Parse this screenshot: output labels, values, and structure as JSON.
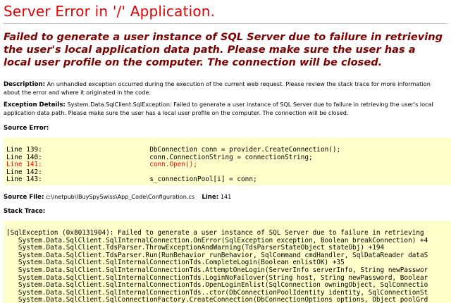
{
  "page": {
    "title": "Server Error in '/' Application.",
    "error_message": "Failed to generate a user instance of SQL Server due to failure in retrieving the user's local application data path. Please make sure the user has a local user profile on the computer. The connection will be closed."
  },
  "description": {
    "label": "Description:",
    "text": "An unhandled exception occurred during the execution of the current web request. Please review the stack trace for more information about the error and where it originated in the code."
  },
  "exception_details": {
    "label": "Exception Details:",
    "text": "System.Data.SqlClient.SqlException: Failed to generate a user instance of SQL Server due to failure in retrieving the user's local application data path. Please make sure the user has a local user profile on the computer. The connection will be closed."
  },
  "source_error": {
    "label": "Source Error:",
    "lines": [
      {
        "line": "Line 139:",
        "code": "DbConnection conn = provider.CreateConnection();",
        "highlight": false
      },
      {
        "line": "Line 140:",
        "code": "conn.ConnectionString = connectionString;",
        "highlight": false
      },
      {
        "line": "Line 141:",
        "code": "conn.Open();",
        "highlight": true
      },
      {
        "line": "Line 142:",
        "code": "",
        "highlight": false
      },
      {
        "line": "Line 143:",
        "code": "s_connectionPool[i] = conn;",
        "highlight": false
      }
    ]
  },
  "source_file": {
    "label": "Source File:",
    "path": "c:\\inetpub\\IBuySpySwiss\\App_Code\\Configuration.cs",
    "line_label": "Line:",
    "line_number": "141"
  },
  "stack_trace": {
    "label": "Stack Trace:",
    "lines": [
      "[SqlException (0x80131904): Failed to generate a user instance of SQL Server due to failure in retrieving",
      "   System.Data.SqlClient.SqlInternalConnection.OnError(SqlException exception, Boolean breakConnection) +4",
      "   System.Data.SqlClient.TdsParser.ThrowExceptionAndWarning(TdsParserStateObject stateObj) +194",
      "   System.Data.SqlClient.TdsParser.Run(RunBehavior runBehavior, SqlCommand cmdHandler, SqlDataReader dataS",
      "   System.Data.SqlClient.SqlInternalConnectionTds.CompleteLogin(Boolean enlistOK) +35",
      "   System.Data.SqlClient.SqlInternalConnectionTds.AttemptOneLogin(ServerInfo serverInfo, String newPasswor",
      "   System.Data.SqlClient.SqlInternalConnectionTds.LoginNoFailover(String host, String newPassword, Boolear",
      "   System.Data.SqlClient.SqlInternalConnectionTds.OpenLoginEnlist(SqlConnection owningObject, SqlConnectio",
      "   System.Data.SqlClient.SqlInternalConnectionTds..ctor(DbConnectionPoolIdentity identity, SqlConnectionSt",
      "   System.Data.SqlClient.SqlConnectionFactory.CreateConnection(DbConnectionOptions options, Object poolGrd"
    ]
  }
}
